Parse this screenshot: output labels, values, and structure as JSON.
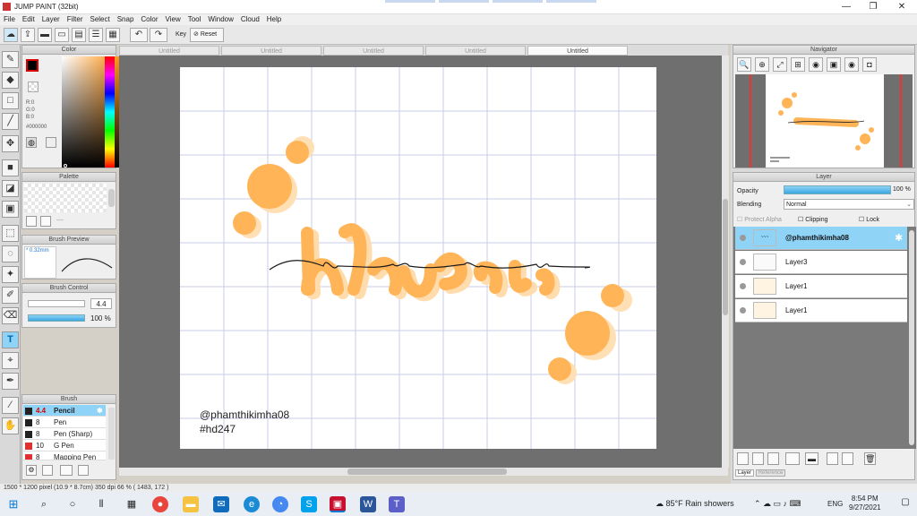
{
  "app": {
    "title": "JUMP PAINT (32bit)"
  },
  "menu": [
    "File",
    "Edit",
    "Layer",
    "Filter",
    "Select",
    "Snap",
    "Color",
    "View",
    "Tool",
    "Window",
    "Cloud",
    "Help"
  ],
  "toolbar": {
    "key_label": "Key",
    "reset_label": "Reset"
  },
  "tabs": [
    "Untitled",
    "Untitled",
    "Untitled",
    "Untitled",
    "Untitled"
  ],
  "color_panel": {
    "title": "Color",
    "r": "R:0",
    "g": "G:0",
    "b": "B:0",
    "hex": "#000000"
  },
  "palette_panel": {
    "title": "Palette",
    "dots": "----"
  },
  "brush_preview": {
    "title": "Brush Preview",
    "size": "* 0.32mm"
  },
  "brush_control": {
    "title": "Brush Control",
    "size": "4.4",
    "opacity": "100 %"
  },
  "brush_panel": {
    "title": "Brush",
    "items": [
      {
        "size": "4.4",
        "name": "Pencil",
        "color": "#222222",
        "selected": true
      },
      {
        "size": "8",
        "name": "Pen",
        "color": "#222222",
        "selected": false
      },
      {
        "size": "8",
        "name": "Pen (Sharp)",
        "color": "#222222",
        "selected": false
      },
      {
        "size": "10",
        "name": "G Pen",
        "color": "#e03030",
        "selected": false
      },
      {
        "size": "8",
        "name": "Mapping Pen",
        "color": "#e03030",
        "selected": false
      }
    ]
  },
  "canvas": {
    "watermark_line1": "@phamthikimha08",
    "watermark_line2": "#hd247",
    "dot_color": "#ffb457"
  },
  "navigator": {
    "title": "Navigator"
  },
  "layer_panel": {
    "title": "Layer",
    "opacity_label": "Opacity",
    "opacity_value": "100 %",
    "blending_label": "Blending",
    "blending_value": "Normal",
    "protect_alpha": "Protect Alpha",
    "clipping": "Clipping",
    "lock": "Lock",
    "layers": [
      {
        "name": "@phamthikimha08",
        "selected": true
      },
      {
        "name": "Layer3",
        "selected": false
      },
      {
        "name": "Layer1",
        "selected": false
      },
      {
        "name": "Layer1",
        "selected": false
      }
    ],
    "bottom_tabs": [
      "Layer",
      "Reference"
    ]
  },
  "status": {
    "text": "1500 * 1200 pixel   (10.9 * 8.7cm)   350 dpi   66 %   ( 1483, 172 )"
  },
  "taskbar": {
    "weather": "85°F  Rain showers",
    "lang": "ENG",
    "time": "8:54 PM",
    "date": "9/27/2021"
  },
  "colors": {
    "accent": "#5ac8f5",
    "selection": "#8fd3f7"
  }
}
